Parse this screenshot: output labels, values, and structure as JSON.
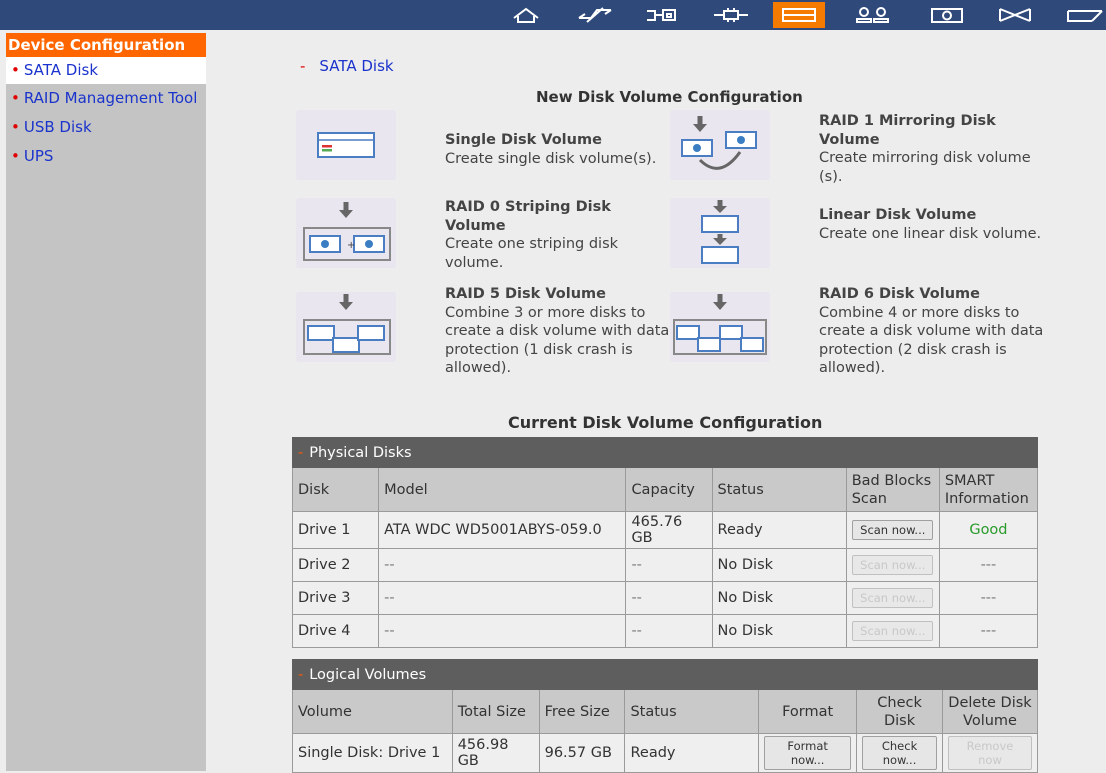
{
  "topbar": {
    "icons": [
      {
        "name": "home-icon"
      },
      {
        "name": "network-icon"
      },
      {
        "name": "services-icon"
      },
      {
        "name": "system-tools-icon"
      },
      {
        "name": "device-config-icon",
        "active": true
      },
      {
        "name": "user-management-icon"
      },
      {
        "name": "disk-status-icon"
      },
      {
        "name": "share-icon"
      },
      {
        "name": "logout-icon"
      }
    ],
    "active_color": "#f47a00",
    "bar_color": "#2f4a7a"
  },
  "sidebar": {
    "title": "Device Configuration",
    "items": [
      {
        "label": "SATA Disk",
        "active": true
      },
      {
        "label": "RAID Management Tool"
      },
      {
        "label": "USB Disk"
      },
      {
        "label": "UPS"
      }
    ]
  },
  "main": {
    "section_link": "SATA Disk",
    "new_config_title": "New Disk Volume Configuration",
    "options": [
      {
        "title": "Single Disk Volume",
        "desc": "Create single disk volume(s)."
      },
      {
        "title": "RAID 1 Mirroring Disk Volume",
        "desc": "Create mirroring disk volume (s)."
      },
      {
        "title": "RAID 0 Striping Disk Volume",
        "desc": "Create one striping disk volume."
      },
      {
        "title": "Linear Disk Volume",
        "desc": "Create one linear disk volume."
      },
      {
        "title": "RAID 5 Disk Volume",
        "desc": "Combine 3 or more disks to create a disk volume with data protection (1 disk crash is allowed)."
      },
      {
        "title": "RAID 6 Disk Volume",
        "desc": "Combine 4 or more disks to create a disk volume with data protection (2 disk crash is allowed)."
      }
    ],
    "current_config_title": "Current Disk Volume Configuration",
    "physical": {
      "bar_label": "Physical Disks",
      "headers": [
        "Disk",
        "Model",
        "Capacity",
        "Status",
        "Bad Blocks Scan",
        "SMART Information"
      ],
      "rows": [
        {
          "disk": "Drive 1",
          "model": "ATA WDC WD5001ABYS-059.0",
          "capacity": "465.76 GB",
          "status": "Ready",
          "scan": "Scan now...",
          "scan_enabled": true,
          "smart": "Good"
        },
        {
          "disk": "Drive 2",
          "model": "--",
          "capacity": "--",
          "status": "No Disk",
          "scan": "Scan now...",
          "scan_enabled": false,
          "smart": "---"
        },
        {
          "disk": "Drive 3",
          "model": "--",
          "capacity": "--",
          "status": "No Disk",
          "scan": "Scan now...",
          "scan_enabled": false,
          "smart": "---"
        },
        {
          "disk": "Drive 4",
          "model": "--",
          "capacity": "--",
          "status": "No Disk",
          "scan": "Scan now...",
          "scan_enabled": false,
          "smart": "---"
        }
      ]
    },
    "logical": {
      "bar_label": "Logical Volumes",
      "headers": [
        "Volume",
        "Total Size",
        "Free Size",
        "Status",
        "Format",
        "Check Disk",
        "Delete Disk Volume"
      ],
      "rows": [
        {
          "volume": "Single Disk: Drive 1",
          "total": "456.98 GB",
          "free": "96.57 GB",
          "status": "Ready",
          "format": "Format now...",
          "check": "Check now...",
          "remove": "Remove now"
        }
      ]
    }
  }
}
